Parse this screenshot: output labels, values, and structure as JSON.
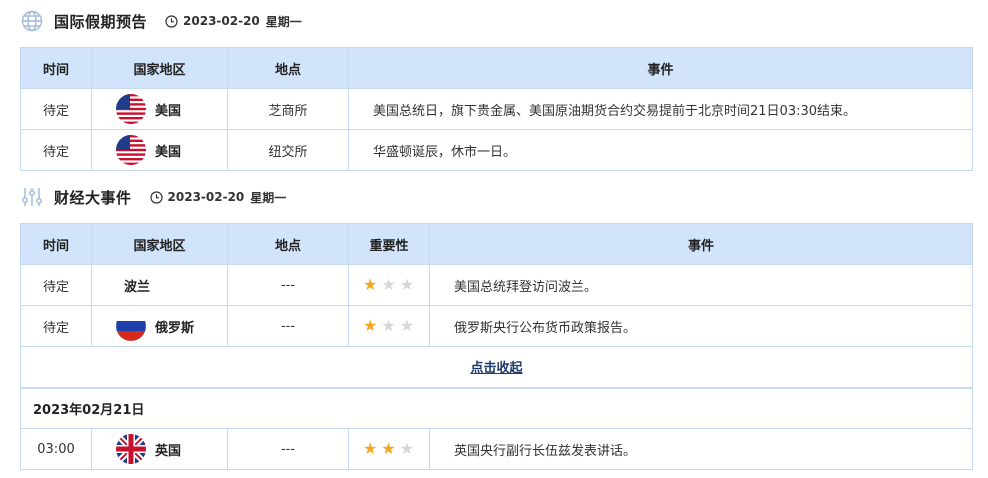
{
  "holiday_section": {
    "title": "国际假期预告",
    "date": "2023-02-20",
    "weekday": "星期一",
    "headers": {
      "time": "时间",
      "country": "国家地区",
      "place": "地点",
      "event": "事件"
    },
    "rows": [
      {
        "time": "待定",
        "flag": "us-flag-icon",
        "country": "美国",
        "place": "芝商所",
        "event": "美国总统日，旗下贵金属、美国原油期货合约交易提前于北京时间21日03:30结束。"
      },
      {
        "time": "待定",
        "flag": "us-flag-icon",
        "country": "美国",
        "place": "纽交所",
        "event": "华盛顿诞辰，休市一日。"
      }
    ]
  },
  "events_section": {
    "title": "财经大事件",
    "date": "2023-02-20",
    "weekday": "星期一",
    "headers": {
      "time": "时间",
      "country": "国家地区",
      "place": "地点",
      "importance": "重要性",
      "event": "事件"
    },
    "rows": [
      {
        "time": "待定",
        "flag": "",
        "country": "波兰",
        "place": "---",
        "importance": 1,
        "event": "美国总统拜登访问波兰。"
      },
      {
        "time": "待定",
        "flag": "russia-flag-icon",
        "country": "俄罗斯",
        "place": "---",
        "importance": 1,
        "event": "俄罗斯央行公布货币政策报告。"
      }
    ],
    "collapse_label": "点击收起",
    "next_date": "2023年02月21日",
    "next_rows": [
      {
        "time": "03:00",
        "flag": "uk-flag-icon",
        "country": "英国",
        "place": "---",
        "importance": 2,
        "event": "英国央行副行长伍兹发表讲话。"
      }
    ]
  },
  "colors": {
    "header_bg": "#d2e4fb",
    "border": "#c7d9ee",
    "star_on": "#f5a623",
    "star_off": "#d6d6d6",
    "link": "#1f3a6b"
  }
}
